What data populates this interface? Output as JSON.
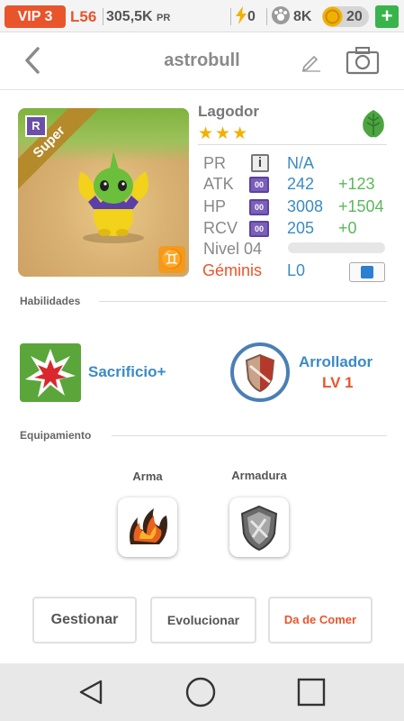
{
  "status": {
    "vip": "VIP 3",
    "level": "L56",
    "pr_value": "305,5K",
    "pr_unit": "PR",
    "energy": "0",
    "food": "8K",
    "gold": "20",
    "plus": "+"
  },
  "header": {
    "title": "astrobull"
  },
  "monster": {
    "rank": "R",
    "ribbon": "Super",
    "zodiac_symbol": "♊",
    "name": "Lagodor",
    "stars": "★★★",
    "element": "leaf-icon",
    "stats": {
      "pr_label": "PR",
      "pr_value": "N/A",
      "atk_label": "ATK",
      "atk_value": "242",
      "atk_bonus": "+123",
      "hp_label": "HP",
      "hp_value": "3008",
      "hp_bonus": "+1504",
      "rcv_label": "RCV",
      "rcv_value": "205",
      "rcv_bonus": "+0",
      "level_label": "Nivel 04",
      "gem_label": "Géminis",
      "gem_value": "L0"
    },
    "xp_progress": 0
  },
  "skills": {
    "section_title": "Habilidades",
    "skill_name": "Sacrificio+",
    "ability_name": "Arrollador",
    "ability_level": "LV 1"
  },
  "equipment": {
    "section_title": "Equipamiento",
    "weapon_label": "Arma",
    "armor_label": "Armadura"
  },
  "actions": {
    "manage": "Gestionar",
    "evolve": "Evolucionar",
    "feed": "Da de Comer"
  },
  "colors": {
    "accent": "#e8552c",
    "blue": "#3b8bc4",
    "green": "#5bb85a",
    "gold_star": "#f2b100"
  }
}
